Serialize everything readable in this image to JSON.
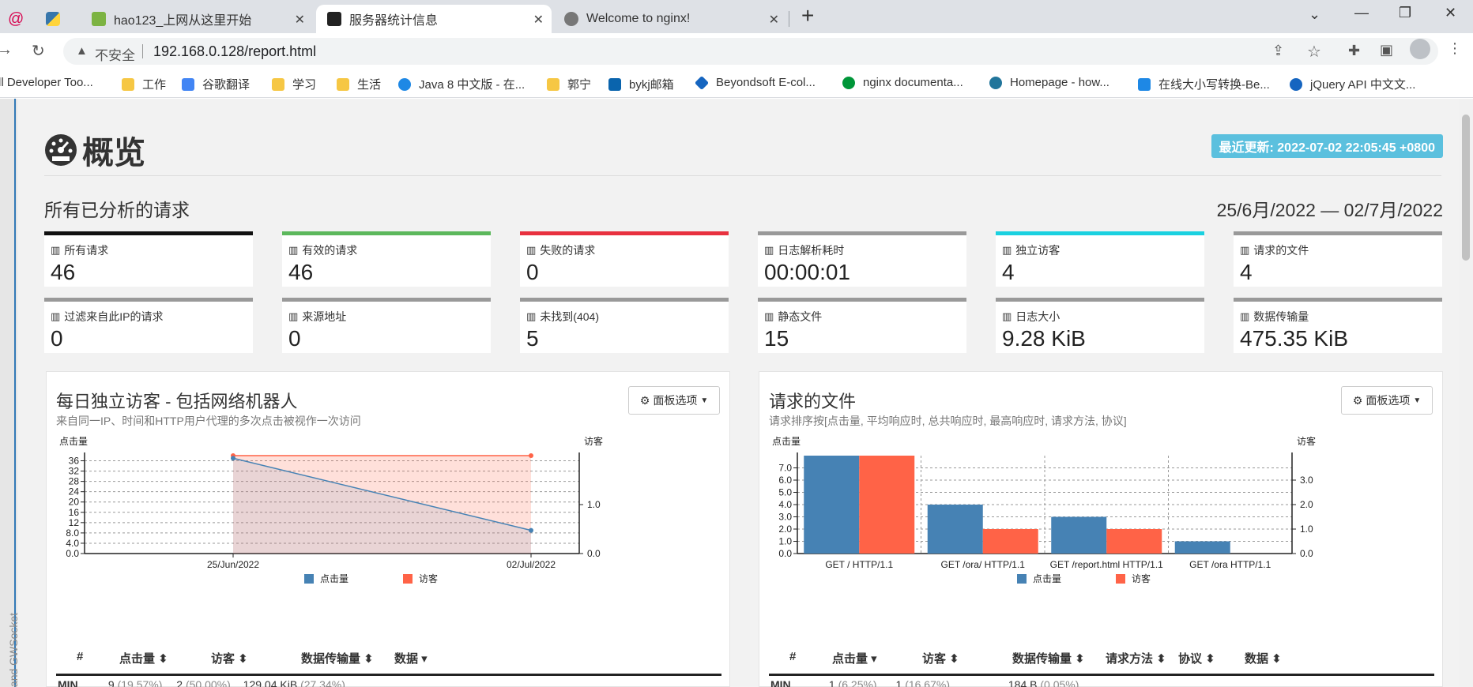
{
  "browser": {
    "tabs": [
      {
        "label": ""
      },
      {
        "label": ""
      },
      {
        "label": "hao123_上网从这里开始"
      },
      {
        "label": "服务器统计信息"
      },
      {
        "label": "Welcome to nginx!"
      }
    ],
    "new_tab": "+",
    "insecure_label": "不安全",
    "url": "192.168.0.128/report.html",
    "bookmarks": [
      {
        "label": "ll Developer Too...",
        "color": "#888888"
      },
      {
        "label": "工作",
        "color": "#f6c744"
      },
      {
        "label": "谷歌翻译",
        "color": "#4285f4"
      },
      {
        "label": "学习",
        "color": "#f6c744"
      },
      {
        "label": "生活",
        "color": "#f6c744"
      },
      {
        "label": "Java 8 中文版 - 在...",
        "color": "#1e88e5"
      },
      {
        "label": "郭宁",
        "color": "#f6c744"
      },
      {
        "label": "bykj邮箱",
        "color": "#0a64ad"
      },
      {
        "label": "Beyondsoft E-col...",
        "color": "#1565c0"
      },
      {
        "label": "nginx documenta...",
        "color": "#009639"
      },
      {
        "label": "Homepage - how...",
        "color": "#21759b"
      },
      {
        "label": "在线大小写转换-Be...",
        "color": "#1e88e5"
      },
      {
        "label": "jQuery API 中文文...",
        "color": "#1565c0"
      }
    ]
  },
  "page": {
    "title": "概览",
    "last_update": "最近更新: 2022-07-02 22:05:45 +0800",
    "section_title": "所有已分析的请求",
    "date_range": "25/6月/2022 — 02/7月/2022",
    "side_text": "and GWSocket",
    "cards": [
      {
        "label": "所有请求",
        "value": "46",
        "color": "#111111"
      },
      {
        "label": "有效的请求",
        "value": "46",
        "color": "#5cb85c"
      },
      {
        "label": "失败的请求",
        "value": "0",
        "color": "#e8313f"
      },
      {
        "label": "日志解析耗时",
        "value": "00:00:01",
        "color": "#999999"
      },
      {
        "label": "独立访客",
        "value": "4",
        "color": "#1ad1e0"
      },
      {
        "label": "请求的文件",
        "value": "4",
        "color": "#999999"
      },
      {
        "label": "过滤来自此IP的请求",
        "value": "0",
        "color": "#999999"
      },
      {
        "label": "来源地址",
        "value": "0",
        "color": "#999999"
      },
      {
        "label": "未找到(404)",
        "value": "5",
        "color": "#999999"
      },
      {
        "label": "静态文件",
        "value": "15",
        "color": "#999999"
      },
      {
        "label": "日志大小",
        "value": "9.28 KiB",
        "color": "#999999"
      },
      {
        "label": "数据传输量",
        "value": "475.35 KiB",
        "color": "#999999"
      }
    ]
  },
  "panels": [
    {
      "title": "每日独立访客 - 包括网络机器人",
      "subtitle": "来自同一IP、时间和HTTP用户代理的多次点击被视作一次访问",
      "options_label": "面板选项",
      "columns": [
        "#",
        "点击量",
        "访客",
        "数据传输量",
        "数据"
      ],
      "row": {
        "label": "MIN",
        "hits": "9",
        "hits_pct": "(19.57%)",
        "visitors": "2",
        "visitors_pct": "(50.00%)",
        "bw": "129.04 KiB",
        "bw_pct": "(27.34%)"
      }
    },
    {
      "title": "请求的文件",
      "subtitle": "请求排序按[点击量, 平均响应时, 总共响应时, 最高响应时, 请求方法, 协议]",
      "options_label": "面板选项",
      "columns": [
        "#",
        "点击量",
        "访客",
        "数据传输量",
        "请求方法",
        "协议",
        "数据"
      ],
      "row": {
        "label": "MIN",
        "hits": "1",
        "hits_pct": "(6.25%)",
        "visitors": "1",
        "visitors_pct": "(16.67%)",
        "bw": "184 B",
        "bw_pct": "(0.05%)"
      }
    }
  ],
  "chart_data": [
    {
      "type": "area",
      "title": "每日独立访客 - 包括网络机器人",
      "x": [
        "25/Jun/2022",
        "02/Jul/2022"
      ],
      "ylabel": "点击量",
      "y2label": "访客",
      "ylim": [
        0,
        38
      ],
      "y2lim": [
        0,
        2
      ],
      "yticks": [
        "0.0",
        "4.0",
        "8.0",
        "12",
        "16",
        "20",
        "24",
        "28",
        "32",
        "36"
      ],
      "y2ticks": [
        "0.0",
        "1.0"
      ],
      "series": [
        {
          "name": "点击量",
          "axis": "left",
          "values": [
            37,
            9
          ],
          "color": "#4682b4"
        },
        {
          "name": "访客",
          "axis": "right",
          "values": [
            2,
            2
          ],
          "color": "#ff6347"
        }
      ],
      "legend": "bottom",
      "grid": true
    },
    {
      "type": "bar",
      "title": "请求的文件",
      "categories": [
        "GET / HTTP/1.1",
        "GET /ora/ HTTP/1.1",
        "GET /report.html HTTP/1.1",
        "GET /ora HTTP/1.1"
      ],
      "ylabel": "点击量",
      "y2label": "访客",
      "ylim": [
        0,
        8
      ],
      "y2lim": [
        0,
        4
      ],
      "yticks": [
        "0.0",
        "1.0",
        "2.0",
        "3.0",
        "4.0",
        "5.0",
        "6.0",
        "7.0"
      ],
      "y2ticks": [
        "0.0",
        "1.0",
        "2.0",
        "3.0"
      ],
      "series": [
        {
          "name": "点击量",
          "axis": "left",
          "values": [
            8,
            4,
            3,
            1
          ],
          "color": "#4682b4"
        },
        {
          "name": "访客",
          "axis": "right",
          "values": [
            4,
            1,
            1,
            0
          ],
          "color": "#ff6347"
        }
      ],
      "legend": "bottom",
      "grid": true
    }
  ]
}
